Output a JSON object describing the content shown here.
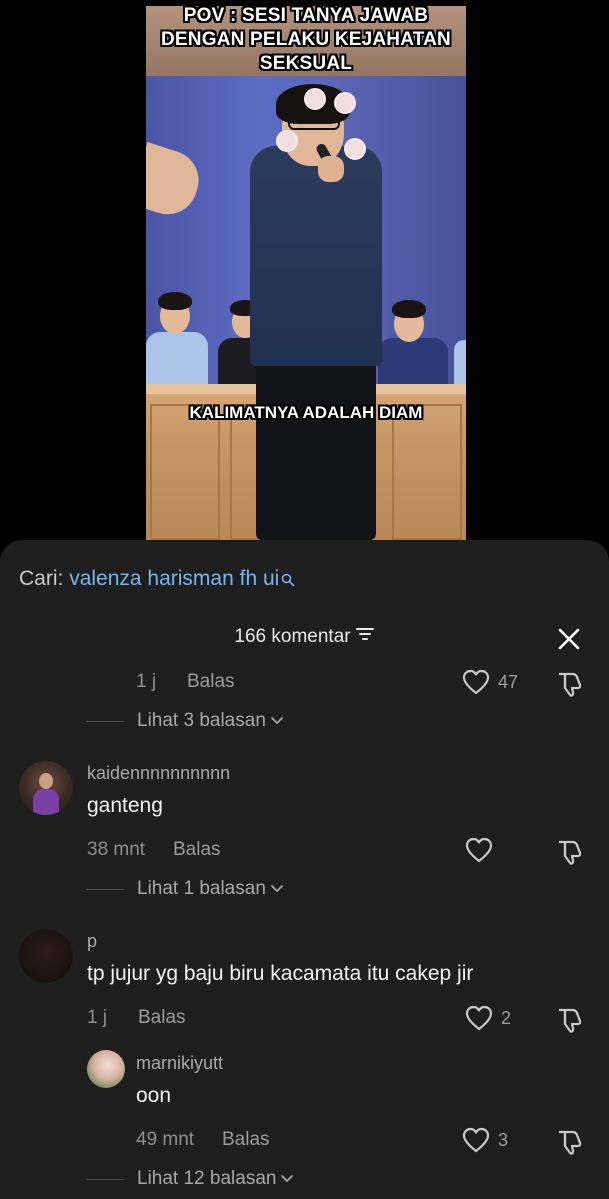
{
  "video": {
    "caption_top": "POV : SESI TANYA JAWAB\nDENGAN PELAKU KEJAHATAN\nSEKSUAL",
    "caption_mid": "KALIMATNYA ADALAH DIAM"
  },
  "search": {
    "prefix": "Cari:",
    "term": "valenza harisman fh ui"
  },
  "comments_header": {
    "count_label": "166 komentar"
  },
  "comments": [
    {
      "time": "1 j",
      "reply_label": "Balas",
      "likes": "47",
      "more_replies": "Lihat 3 balasan"
    },
    {
      "username": "kaidennnnnnnnnn",
      "text": "ganteng",
      "time": "38 mnt",
      "reply_label": "Balas",
      "likes": "",
      "more_replies": "Lihat 1 balasan"
    },
    {
      "username": "p",
      "text": "tp jujur yg baju biru kacamata itu cakep jir",
      "time": "1 j",
      "reply_label": "Balas",
      "likes": "2",
      "replies": [
        {
          "username": "marnikiyutt",
          "text": "oon",
          "time": "49 mnt",
          "reply_label": "Balas",
          "likes": "3"
        }
      ],
      "more_replies": "Lihat 12 balasan"
    }
  ],
  "colors": {
    "sheet_bg": "#1e1e1e",
    "link_blue": "#73b6f4",
    "muted_text": "#8f8f8f"
  },
  "icons": [
    "search-icon",
    "filter-icon",
    "close-icon",
    "heart-icon",
    "dislike-icon",
    "chevron-down-icon"
  ]
}
